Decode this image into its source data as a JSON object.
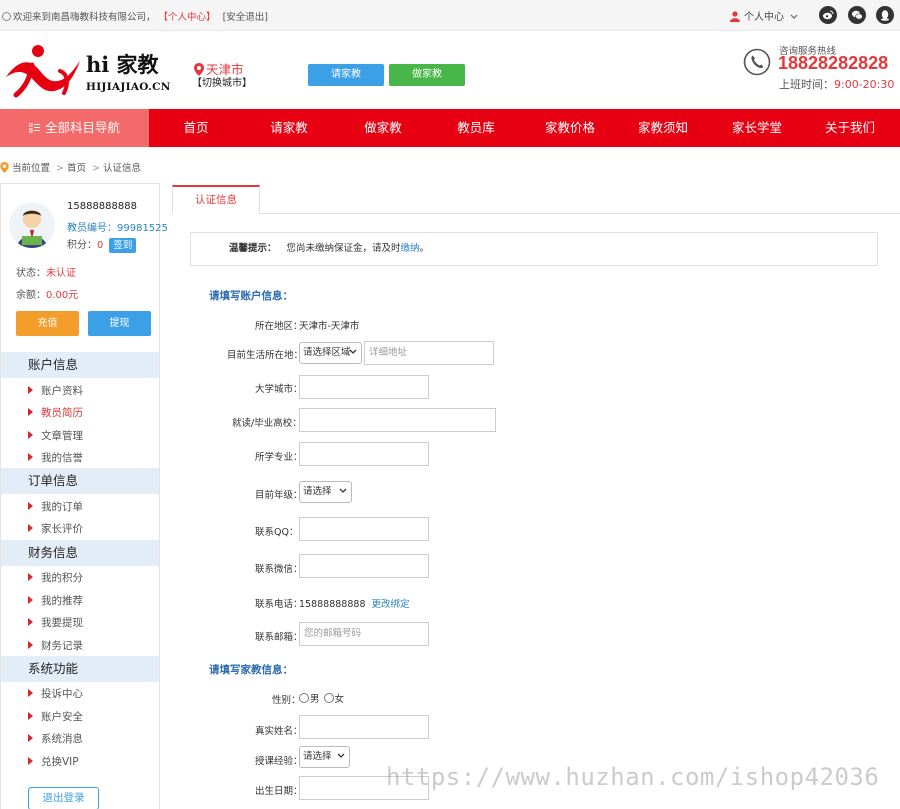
{
  "topbar": {
    "welcome": "欢迎来到南昌嗨教科技有限公司，",
    "personal_center_link": "【个人中心】",
    "logout_link": "[安全退出]",
    "user_menu": "个人中心"
  },
  "header": {
    "logo_title": "hi 家教",
    "logo_domain": "HIJIAJIAO.CN",
    "city": "天津市",
    "switch_city": "【切换城市】",
    "hire_tutor_button": "请家教",
    "be_tutor_button": "做家教",
    "hotline_label": "咨询服务热线",
    "hotline_number": "18828282828",
    "worktime_label": "上班时间：",
    "worktime_value": "9:00-20:30"
  },
  "nav": {
    "all_subjects": "全部科目导航",
    "items": [
      "首页",
      "请家教",
      "做家教",
      "教员库",
      "家教价格",
      "家教须知",
      "家长学堂",
      "关于我们"
    ]
  },
  "breadcrumb": {
    "label": "当前位置",
    "home": "首页",
    "current": "认证信息",
    "separator": ">"
  },
  "sidebar": {
    "phone": "15888888888",
    "teacher_id_label": "教员编号：",
    "teacher_id": "99981525",
    "points_label": "积分：",
    "points": "0",
    "signin_button": "签到",
    "status_label": "状态：",
    "status_value": "未认证",
    "balance_label": "余额：",
    "balance_value": "0.00元",
    "recharge_button": "充值",
    "withdraw_button": "提现",
    "sections": [
      {
        "title": "账户信息",
        "items": [
          "账户资料",
          "教员简历",
          "文章管理",
          "我的信誉"
        ]
      },
      {
        "title": "订单信息",
        "items": [
          "我的订单",
          "家长评价"
        ]
      },
      {
        "title": "财务信息",
        "items": [
          "我的积分",
          "我的推荐",
          "我要提现",
          "财务记录"
        ]
      },
      {
        "title": "系统功能",
        "items": [
          "投诉中心",
          "账户安全",
          "系统消息",
          "兑换VIP"
        ]
      }
    ],
    "logout_button": "退出登录"
  },
  "content": {
    "tab_label": "认证信息",
    "tip_title": "温馨提示：",
    "tip_text": "您尚未缴纳保证金，请及时",
    "tip_link": "缴纳",
    "tip_end": "。",
    "account_section_title": "请填写账户信息：",
    "fields": {
      "region_label": "所在地区：",
      "region_value": "天津市-天津市",
      "residence_label": "目前生活所在地：",
      "residence_select": "请选择区域",
      "residence_placeholder": "详细地址",
      "university_city_label": "大学城市：",
      "school_label": "就读/毕业高校：",
      "major_label": "所学专业：",
      "grade_label": "目前年级：",
      "grade_select": "请选择",
      "qq_label": "联系QQ：",
      "wechat_label": "联系微信：",
      "phone_label": "联系电话：",
      "phone_value": "15888888888",
      "change_binding_link": "更改绑定",
      "email_label": "联系邮箱：",
      "email_placeholder": "您的邮箱号码"
    },
    "tutor_section_title": "请填写家教信息：",
    "tutor_fields": {
      "gender_label": "性别：",
      "gender_male": "男",
      "gender_female": "女",
      "real_name_label": "真实姓名：",
      "experience_label": "授课经验：",
      "experience_select": "请选择",
      "birthdate_label": "出生日期："
    }
  },
  "watermark": "https://www.huzhan.com/ishop42036",
  "colors": {
    "brand_red": "#e60012",
    "accent_blue": "#3ca0e6",
    "accent_green": "#48b648",
    "accent_orange": "#f39d2a"
  }
}
